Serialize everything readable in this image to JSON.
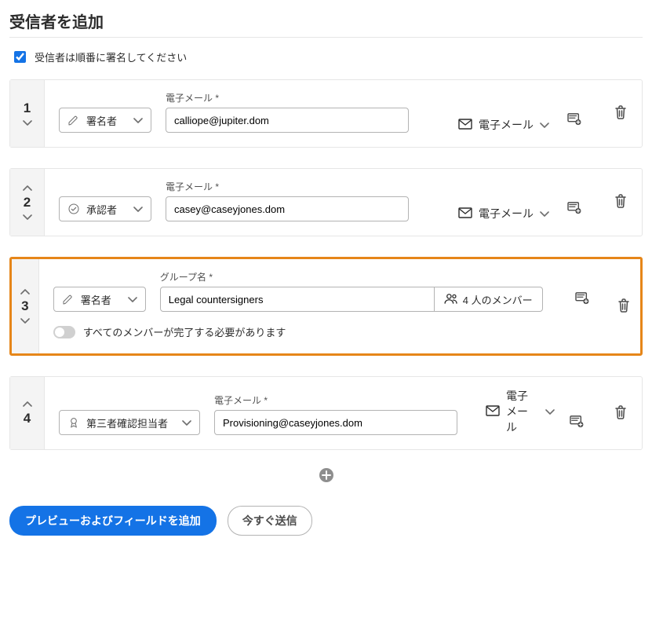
{
  "title": "受信者を追加",
  "sign_order_label": "受信者は順番に署名してください",
  "sign_order_checked": true,
  "labels": {
    "email": "電子メール *",
    "group_name": "グループ名 *",
    "delivery_email": "電子メール",
    "all_must_complete": "すべてのメンバーが完了する必要があります"
  },
  "recipients": [
    {
      "order": "1",
      "role": "署名者",
      "role_type": "signer",
      "field_kind": "email",
      "value": "calliope@jupiter.dom",
      "delivery": "電子メール",
      "show_up": false,
      "show_down": true,
      "highlighted": false
    },
    {
      "order": "2",
      "role": "承認者",
      "role_type": "approver",
      "field_kind": "email",
      "value": "casey@caseyjones.dom",
      "delivery": "電子メール",
      "show_up": true,
      "show_down": true,
      "highlighted": false
    },
    {
      "order": "3",
      "role": "署名者",
      "role_type": "signer",
      "field_kind": "group",
      "value": "Legal countersigners",
      "members_label": "4 人のメンバー",
      "show_up": true,
      "show_down": true,
      "highlighted": true,
      "toggle_on": false
    },
    {
      "order": "4",
      "role": "第三者確認担当者",
      "role_type": "witness",
      "role_wide": true,
      "field_kind": "email",
      "value": "Provisioning@caseyjones.dom",
      "delivery": "電子メール",
      "show_up": true,
      "show_down": false,
      "highlighted": false
    }
  ],
  "footer": {
    "preview": "プレビューおよびフィールドを追加",
    "send_now": "今すぐ送信"
  }
}
